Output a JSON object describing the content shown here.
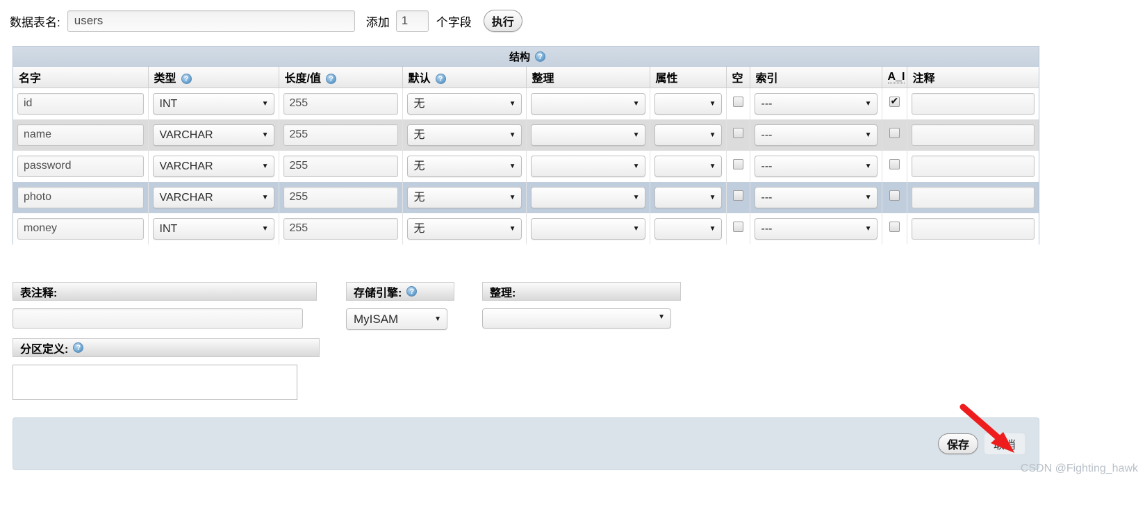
{
  "topbar": {
    "table_name_label": "数据表名:",
    "table_name_value": "users",
    "add_label": "添加",
    "field_count_value": "1",
    "field_unit_label": "个字段",
    "go_button_label": "执行"
  },
  "structure": {
    "section_title": "结构",
    "help_icon_glyph": "?",
    "columns": [
      "名字",
      "类型",
      "长度/值",
      "默认",
      "整理",
      "属性",
      "空",
      "索引",
      "A_I",
      "注释"
    ],
    "rows": [
      {
        "name": "id",
        "type": "INT",
        "length": "255",
        "default": "无",
        "collation": "",
        "attributes": "",
        "null": false,
        "index": "---",
        "ai": true,
        "comment": ""
      },
      {
        "name": "name",
        "type": "VARCHAR",
        "length": "255",
        "default": "无",
        "collation": "",
        "attributes": "",
        "null": false,
        "index": "---",
        "ai": false,
        "comment": ""
      },
      {
        "name": "password",
        "type": "VARCHAR",
        "length": "255",
        "default": "无",
        "collation": "",
        "attributes": "",
        "null": false,
        "index": "---",
        "ai": false,
        "comment": ""
      },
      {
        "name": "photo",
        "type": "VARCHAR",
        "length": "255",
        "default": "无",
        "collation": "",
        "attributes": "",
        "null": false,
        "index": "---",
        "ai": false,
        "comment": ""
      },
      {
        "name": "money",
        "type": "INT",
        "length": "255",
        "default": "无",
        "collation": "",
        "attributes": "",
        "null": false,
        "index": "---",
        "ai": false,
        "comment": ""
      }
    ]
  },
  "options": {
    "table_comment_label": "表注释:",
    "table_comment_value": "",
    "storage_engine_label": "存储引擎:",
    "storage_engine_value": "MyISAM",
    "collation_label": "整理:",
    "collation_value": "",
    "partition_label": "分区定义:",
    "partition_value": ""
  },
  "footer": {
    "save_label": "保存",
    "cancel_label": "取消"
  },
  "annotation": {
    "arrow_color": "#ee1c1c"
  },
  "watermark": {
    "text": "CSDN @Fighting_hawk"
  }
}
